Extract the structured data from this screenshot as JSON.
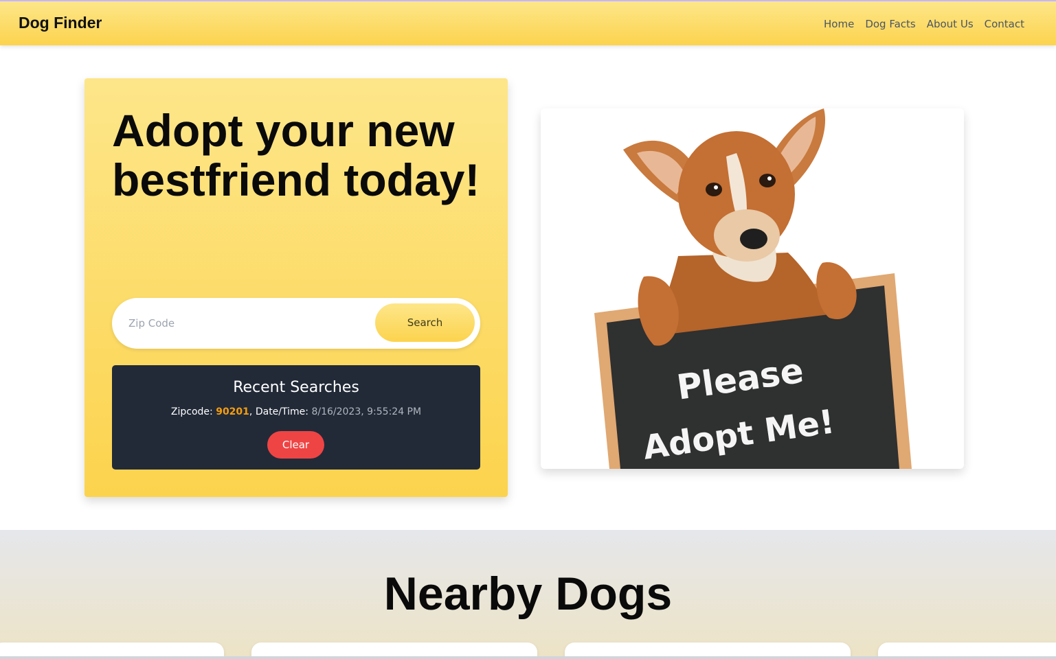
{
  "header": {
    "brand": "Dog Finder",
    "nav": [
      "Home",
      "Dog Facts",
      "About Us",
      "Contact"
    ]
  },
  "hero": {
    "title": "Adopt your new bestfriend today!",
    "search": {
      "placeholder": "Zip Code",
      "value": "",
      "button_label": "Search"
    },
    "recent": {
      "title": "Recent Searches",
      "zip_label": "Zipcode:",
      "zip_value": "90201",
      "date_label": "Date/Time:",
      "date_value": "8/16/2023, 9:55:24 PM",
      "clear_label": "Clear"
    }
  },
  "image": {
    "sign_line1": "Please",
    "sign_line2": "Adopt Me!"
  },
  "nearby": {
    "title": "Nearby Dogs"
  },
  "colors": {
    "brand_yellow": "#fcd34d",
    "dark_panel": "#222a38",
    "accent_orange": "#f59e0b",
    "clear_red": "#ef4444"
  }
}
